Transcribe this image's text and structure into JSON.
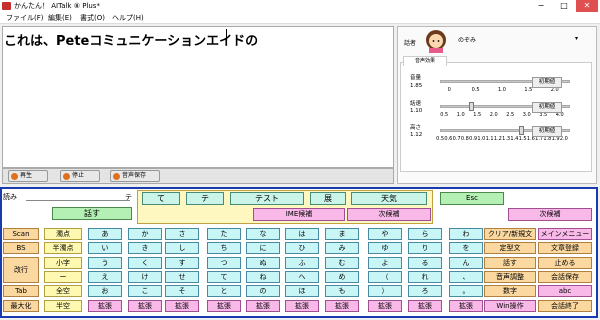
{
  "window": {
    "title": "かんたん！ AITalk ⑧ Plus*",
    "min": "−",
    "max": "□",
    "close": "✕"
  },
  "menu": [
    "ファイル(F)",
    "編集(E)",
    "書式(O)",
    "ヘルプ(H)"
  ],
  "editor": {
    "text": "これは、Peteコミュニケーションエイドの"
  },
  "controls": {
    "play": "再生",
    "stop": "停止",
    "save": "音声保存"
  },
  "speaker": {
    "label": "話者",
    "name": "のぞみ"
  },
  "effects": {
    "tab": "音声効果",
    "volume": {
      "label": "音量",
      "value": "1.85",
      "fraction": 0.925,
      "ticks": [
        "0",
        "0.5",
        "1.0",
        "1.5",
        "2.0"
      ]
    },
    "speed": {
      "label": "話速",
      "value": "1.10",
      "fraction": 0.22,
      "ticks": [
        "0.5",
        "1.0",
        "1.5",
        "2.0",
        "2.5",
        "3.0",
        "3.5",
        "4.0"
      ]
    },
    "pitch": {
      "label": "高さ",
      "value": "1.12",
      "fraction": 0.62,
      "ticks": [
        "0.5",
        "0.6",
        "0.7",
        "0.8",
        "0.9",
        "1.0",
        "1.1",
        "1.2",
        "1.3",
        "1.4",
        "1.5",
        "1.6",
        "1.7",
        "1.8",
        "1.9",
        "2.0"
      ]
    },
    "reset": "初期値"
  },
  "keyboard": {
    "yomi_label": "読み",
    "yomi_value": "テ",
    "hanasu": "話す",
    "candidates": [
      "て",
      "テ",
      "テスト",
      "展",
      "天気"
    ],
    "ime": "IME候補",
    "next": "次候補",
    "esc": "Esc",
    "next_right": "次候補",
    "left_keys": [
      [
        "Scan",
        "濁点"
      ],
      [
        "BS",
        "半濁点"
      ],
      [
        "改行",
        "小字"
      ],
      [
        "",
        "ー"
      ],
      [
        "Tab",
        "全空"
      ],
      [
        "最大化",
        "半空"
      ]
    ],
    "kana_cols": [
      [
        "あ",
        "い",
        "う",
        "え",
        "お",
        "拡張"
      ],
      [
        "か",
        "き",
        "く",
        "け",
        "こ",
        "拡張"
      ],
      [
        "さ",
        "し",
        "す",
        "せ",
        "そ",
        "拡張"
      ],
      [
        "た",
        "ち",
        "つ",
        "て",
        "と",
        "拡張"
      ],
      [
        "な",
        "に",
        "ぬ",
        "ね",
        "の",
        "拡張"
      ],
      [
        "は",
        "ひ",
        "ふ",
        "へ",
        "ほ",
        "拡張"
      ],
      [
        "ま",
        "み",
        "む",
        "め",
        "も",
        "拡張"
      ],
      [
        "や",
        "ゆ",
        "よ",
        "（",
        "）",
        "拡張"
      ],
      [
        "ら",
        "り",
        "る",
        "れ",
        "ろ",
        "拡張"
      ],
      [
        "わ",
        "を",
        "ん",
        "、",
        "。",
        "拡張"
      ]
    ],
    "right_keys": [
      [
        "クリア/新規文",
        "メインメニュー"
      ],
      [
        "定型文",
        "文章登録"
      ],
      [
        "話す",
        "止める"
      ],
      [
        "音声調整",
        "会話保存"
      ],
      [
        "数字",
        "abc"
      ],
      [
        "Win操作",
        "会話終了"
      ]
    ]
  }
}
